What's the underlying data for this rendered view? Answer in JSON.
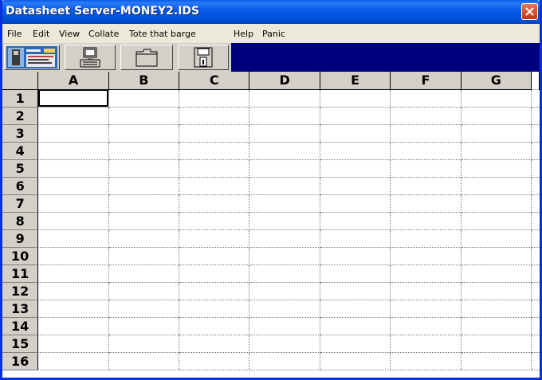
{
  "window": {
    "title": "Datasheet Server-MONEY2.IDS"
  },
  "menu": [
    "File",
    "Edit",
    "View",
    "Collate",
    "Tote that barge",
    "Help",
    "Panic"
  ],
  "toolbar": {
    "buttons": [
      "app-picture-icon",
      "computer-icon",
      "folder-icon",
      "floppy-disk-icon"
    ]
  },
  "sheet": {
    "columns": [
      "A",
      "B",
      "C",
      "D",
      "E",
      "F",
      "G"
    ],
    "rows": [
      "1",
      "2",
      "3",
      "4",
      "5",
      "6",
      "7",
      "8",
      "9",
      "10",
      "11",
      "12",
      "13",
      "14",
      "15",
      "16"
    ],
    "active_cell": "A1"
  },
  "colors": {
    "title_bar": "#0052d8",
    "toolbar_bg": "#00007f",
    "face": "#d4d0c8"
  }
}
